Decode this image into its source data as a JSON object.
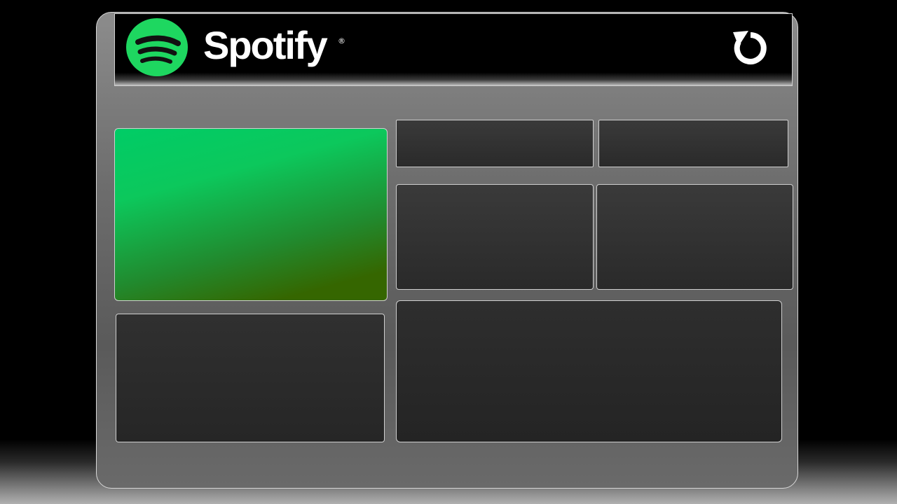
{
  "header": {
    "brand_name": "Spotify",
    "registered_mark": "®",
    "logo_icon": "spotify-logo-icon",
    "refresh_icon": "refresh-icon"
  },
  "colors": {
    "brand_green": "#1ED760",
    "hero_gradient_top": "#00CC66",
    "hero_gradient_bottom": "#356600",
    "panel_bg": "#2E2E2E",
    "frame_bg": "#6E6E6E"
  },
  "panels": {
    "hero": "",
    "top_left": "",
    "top_right": "",
    "middle_left": "",
    "middle_right": "",
    "bottom_left": "",
    "bottom_wide": ""
  }
}
